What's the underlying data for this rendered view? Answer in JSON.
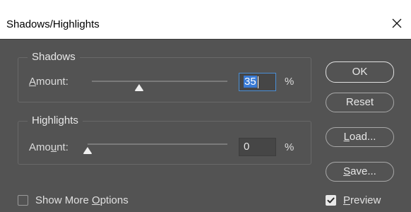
{
  "dialog": {
    "title": "Shadows/Highlights"
  },
  "shadows": {
    "legend": "Shadows",
    "amount_label_prefix": "",
    "amount_label_mnemonic": "A",
    "amount_label_rest": "mount:",
    "value": "35",
    "percent": "%",
    "slider_fraction": 0.35
  },
  "highlights": {
    "legend": "Highlights",
    "amount_label_prefix": "Amo",
    "amount_label_mnemonic": "u",
    "amount_label_rest": "nt:",
    "value": "0",
    "percent": "%",
    "slider_fraction": 0.0
  },
  "buttons": {
    "ok": "OK",
    "reset": "Reset",
    "load_mnemonic": "L",
    "load_rest": "oad...",
    "save_mnemonic": "S",
    "save_rest": "ave..."
  },
  "options": {
    "show_more_prefix": "Show More ",
    "show_more_mnemonic": "O",
    "show_more_rest": "ptions",
    "show_more_checked": false,
    "preview_mnemonic": "P",
    "preview_rest": "review",
    "preview_checked": true
  },
  "icons": {
    "close": "close-icon",
    "thumb": "slider-thumb-icon",
    "check": "checkmark-icon"
  }
}
